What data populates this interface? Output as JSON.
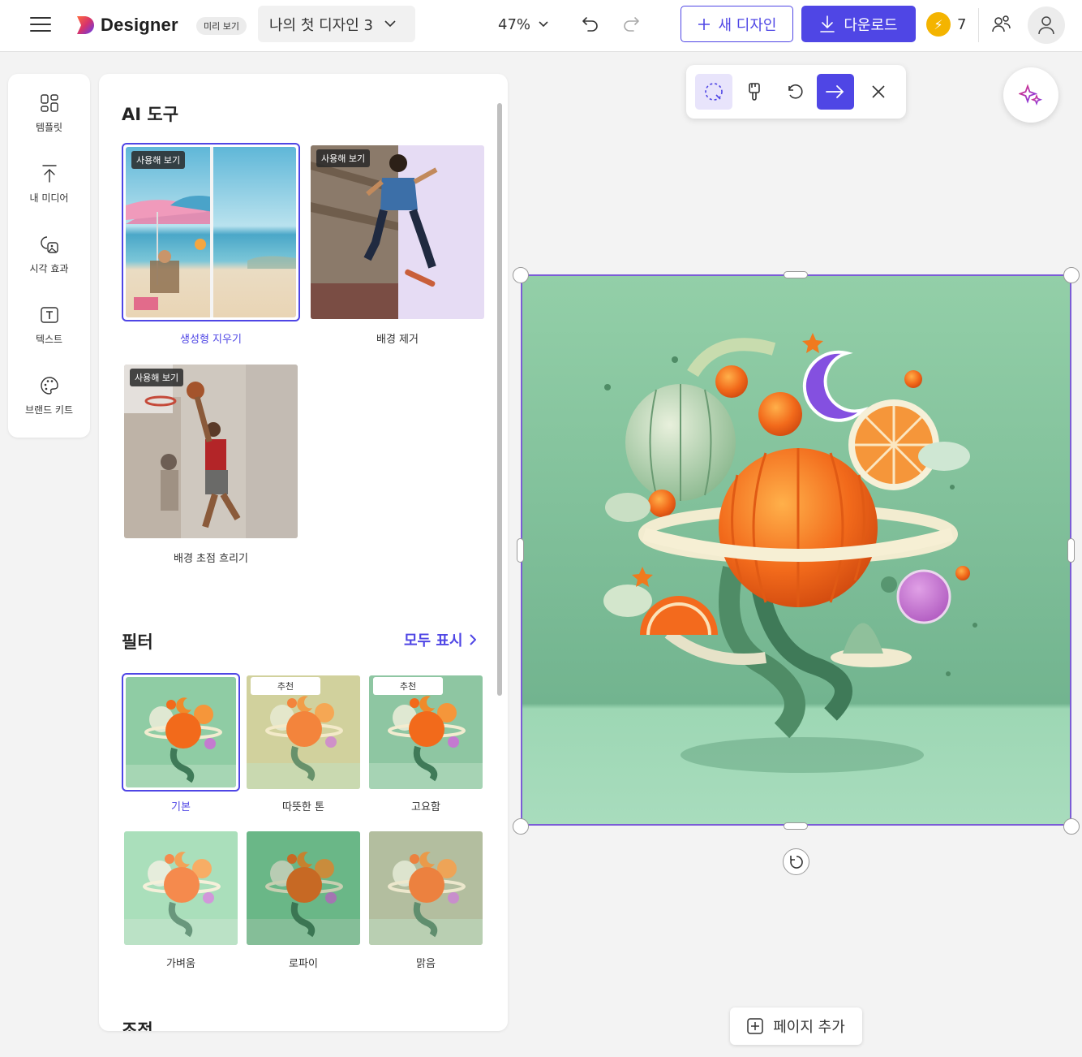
{
  "header": {
    "app_name": "Designer",
    "preview_badge": "미리 보기",
    "doc_title": "나의 첫 디자인 3",
    "zoom": "47%",
    "new_design": "새 디자인",
    "download": "다운로드",
    "credits": "7"
  },
  "rail": {
    "items": [
      {
        "label": "템플릿",
        "icon": "template-icon"
      },
      {
        "label": "내 미디어",
        "icon": "upload-icon"
      },
      {
        "label": "시각 효과",
        "icon": "visuals-icon"
      },
      {
        "label": "텍스트",
        "icon": "text-icon"
      },
      {
        "label": "브랜드 키트",
        "icon": "palette-icon"
      }
    ]
  },
  "panel": {
    "ai_title": "AI 도구",
    "try_badge": "사용해 보기",
    "tools": [
      {
        "label": "생성형 지우기",
        "selected": true
      },
      {
        "label": "배경 제거",
        "selected": false
      },
      {
        "label": "배경 초점 흐리기",
        "selected": false
      }
    ],
    "filter_title": "필터",
    "show_all": "모두 표시",
    "recommended": "추천",
    "filters": [
      {
        "label": "기본",
        "selected": true,
        "rec": false
      },
      {
        "label": "따뜻한 톤",
        "selected": false,
        "rec": true
      },
      {
        "label": "고요함",
        "selected": false,
        "rec": true
      },
      {
        "label": "가벼움",
        "selected": false,
        "rec": false
      },
      {
        "label": "로파이",
        "selected": false,
        "rec": false
      },
      {
        "label": "맑음",
        "selected": false,
        "rec": false
      }
    ],
    "adjust_title": "조정"
  },
  "canvas": {
    "add_page": "페이지 추가"
  },
  "colors": {
    "accent": "#4f46e5",
    "canvas_bg": "#8cc9a4",
    "selection": "#7b5cd6"
  }
}
